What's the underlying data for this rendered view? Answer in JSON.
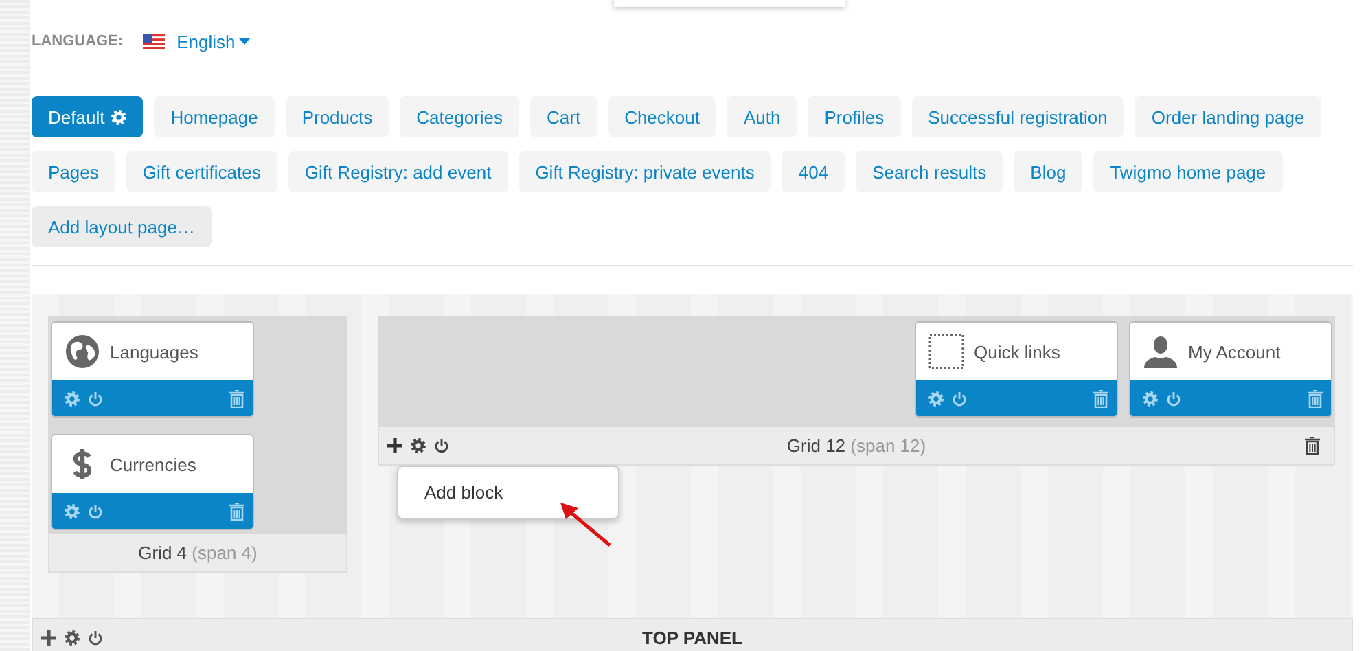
{
  "language": {
    "label": "LANGUAGE:",
    "value": "English"
  },
  "layout_tabs": [
    {
      "label": "Default",
      "selected": true
    },
    {
      "label": "Homepage",
      "selected": false
    },
    {
      "label": "Products",
      "selected": false
    },
    {
      "label": "Categories",
      "selected": false
    },
    {
      "label": "Cart",
      "selected": false
    },
    {
      "label": "Checkout",
      "selected": false
    },
    {
      "label": "Auth",
      "selected": false
    },
    {
      "label": "Profiles",
      "selected": false
    },
    {
      "label": "Successful registration",
      "selected": false
    },
    {
      "label": "Order landing page",
      "selected": false
    },
    {
      "label": "Pages",
      "selected": false
    },
    {
      "label": "Gift certificates",
      "selected": false
    },
    {
      "label": "Gift Registry: add event",
      "selected": false
    },
    {
      "label": "Gift Registry: private events",
      "selected": false
    },
    {
      "label": "404",
      "selected": false
    },
    {
      "label": "Search results",
      "selected": false
    },
    {
      "label": "Blog",
      "selected": false
    },
    {
      "label": "Twigmo home page",
      "selected": false
    }
  ],
  "add_layout_page": "Add layout page…",
  "grids": [
    {
      "title": "Grid 4",
      "span": "(span 4)",
      "controls": false,
      "blocks": [
        {
          "name": "Languages",
          "kind": "globe"
        },
        {
          "name": "Currencies",
          "kind": "dollar"
        }
      ]
    },
    {
      "title": "Grid 12",
      "span": "(span 12)",
      "controls": true,
      "menu": [
        "Add block"
      ],
      "blocks": [
        {
          "name": "Quick links",
          "kind": "placeholder"
        },
        {
          "name": "My Account",
          "kind": "account"
        }
      ]
    }
  ],
  "container": {
    "title": "TOP PANEL"
  }
}
